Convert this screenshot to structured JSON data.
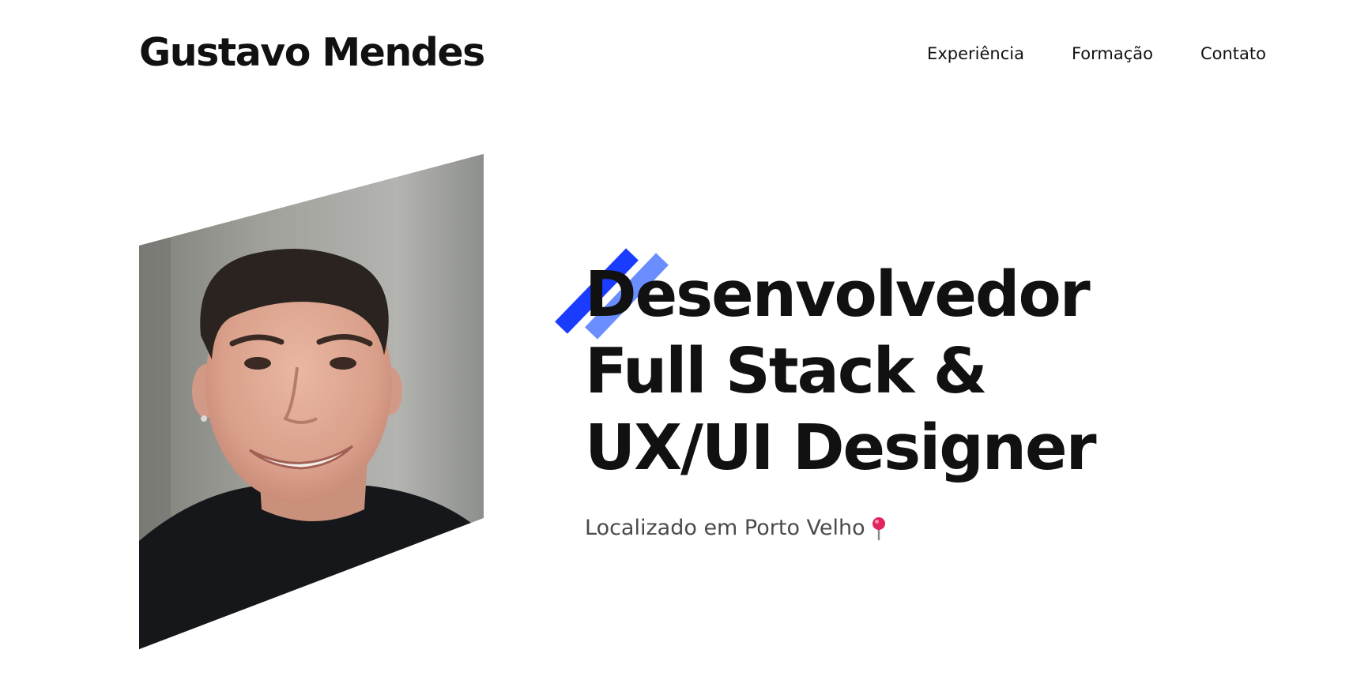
{
  "header": {
    "brand": "Gustavo Mendes",
    "nav": [
      {
        "label": "Experiência"
      },
      {
        "label": "Formação"
      },
      {
        "label": "Contato"
      }
    ]
  },
  "hero": {
    "headline_lines": [
      "Desenvolvedor",
      "Full Stack &",
      "UX/UI Designer"
    ],
    "location": "Localizado em Porto Velho",
    "location_icon": "map-pin-icon",
    "photo": "profile-photo",
    "accent_icon": "double-slash-accent"
  },
  "colors": {
    "text": "#111111",
    "subtext": "#4a4a4a",
    "accent_dark": "#1a3cff",
    "accent_light": "#6a8dff",
    "pin": "#e0245e"
  }
}
